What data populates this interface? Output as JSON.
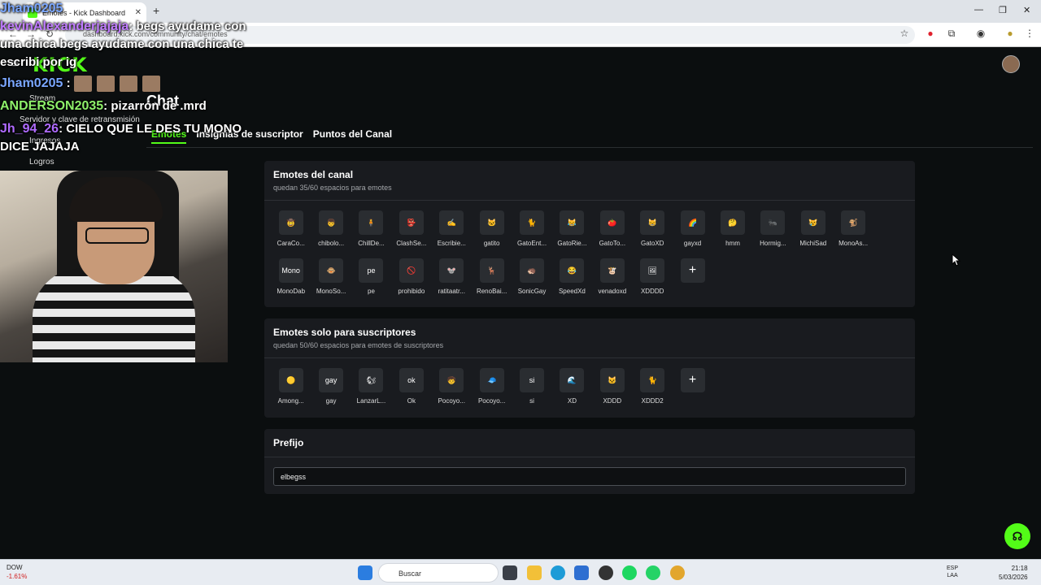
{
  "browser": {
    "tab_title": "Emotes - Kick Dashboard",
    "tab_close": "✕",
    "new_tab": "+",
    "address": "dashboard.kick.com/community/chat/emotes",
    "window_controls": [
      "—",
      "❐",
      "✕"
    ]
  },
  "kick": {
    "logo": "KICK",
    "page_title": "Chat",
    "sidebar": [
      "Stream",
      "Servidor y clave de retransmisión",
      "Ingresos",
      "Logros"
    ],
    "tabs": [
      "Emotes",
      "Insignias de suscriptor",
      "Puntos del Canal"
    ],
    "active_tab": 0
  },
  "channel_emotes": {
    "title": "Emotes del canal",
    "subtitle": "quedan 35/60 espacios para emotes",
    "items": [
      {
        "name": "CaraCo...",
        "icon": "🤠"
      },
      {
        "name": "chibolo...",
        "icon": "👦"
      },
      {
        "name": "ChillDe...",
        "icon": "🧍"
      },
      {
        "name": "ClashSe...",
        "icon": "👺"
      },
      {
        "name": "Escribie...",
        "icon": "✍"
      },
      {
        "name": "gatito",
        "icon": "🐱"
      },
      {
        "name": "GatoEnt...",
        "icon": "🐈"
      },
      {
        "name": "GatoRie...",
        "icon": "😹"
      },
      {
        "name": "GatoTo...",
        "icon": "🍅"
      },
      {
        "name": "GatoXD",
        "icon": "😸"
      },
      {
        "name": "gayxd",
        "icon": "🌈"
      },
      {
        "name": "hmm",
        "icon": "🤔"
      },
      {
        "name": "Hormig...",
        "icon": "🐜"
      },
      {
        "name": "MichiSad",
        "icon": "😿"
      },
      {
        "name": "MonoAs...",
        "icon": "🐒"
      },
      {
        "name": "MonoDab",
        "icon": "Mono"
      },
      {
        "name": "MonoSo...",
        "icon": "🐵"
      },
      {
        "name": "pe",
        "icon": "pe"
      },
      {
        "name": "prohibido",
        "icon": "🚫"
      },
      {
        "name": "ratitaatr...",
        "icon": "🐭"
      },
      {
        "name": "RenoBai...",
        "icon": "🦌"
      },
      {
        "name": "SonicGay",
        "icon": "🦔"
      },
      {
        "name": "SpeedXd",
        "icon": "😂"
      },
      {
        "name": "venadoxd",
        "icon": "🐮"
      },
      {
        "name": "XDDDD",
        "icon": "🖼"
      }
    ],
    "add_label": "+"
  },
  "sub_emotes": {
    "title": "Emotes solo para suscriptores",
    "subtitle": "quedan 50/60 espacios para emotes de suscriptores",
    "items": [
      {
        "name": "Among...",
        "icon": "🟡"
      },
      {
        "name": "gay",
        "icon": "gay"
      },
      {
        "name": "LanzarL...",
        "icon": "🐿"
      },
      {
        "name": "Ok",
        "icon": "ok"
      },
      {
        "name": "Pocoyo...",
        "icon": "🧒"
      },
      {
        "name": "Pocoyo...",
        "icon": "🧢"
      },
      {
        "name": "si",
        "icon": "si"
      },
      {
        "name": "XD",
        "icon": "🌊"
      },
      {
        "name": "XDDD",
        "icon": "🐱"
      },
      {
        "name": "XDDD2",
        "icon": "🐈"
      }
    ],
    "add_label": "+"
  },
  "prefix": {
    "title": "Prefijo",
    "value": "elbegss"
  },
  "chat_overlay": [
    {
      "user": "Jham0205",
      "user_color": "#7aa7ff",
      "text": ""
    },
    {
      "user": "kevinAlexanderjajaja",
      "user_color": "#c07bff",
      "text": ": begs ayudame con una chica begs ayudame con una chica te escribi por ig"
    },
    {
      "user": "Jham0205",
      "user_color": "#7aa7ff",
      "text": ":"
    },
    {
      "user": "ANDERSON2035",
      "user_color": "#8ef06a",
      "text": ": pizarrón de .mrd"
    },
    {
      "user": "Jh_94_26",
      "user_color": "#b06bff",
      "text": ": CIELO QUE LE DES TU MONO DICE JAJAJA"
    }
  ],
  "taskbar": {
    "stock_name": "DOW",
    "stock_change": "-1.61%",
    "search_placeholder": "Buscar",
    "lang_top": "ESP",
    "lang_bottom": "LAA",
    "time": "21:18",
    "date": "5/03/2026"
  },
  "colors": {
    "accent": "#53fc18",
    "card_bg": "#191b1f",
    "page_bg": "#0b0e0f"
  }
}
